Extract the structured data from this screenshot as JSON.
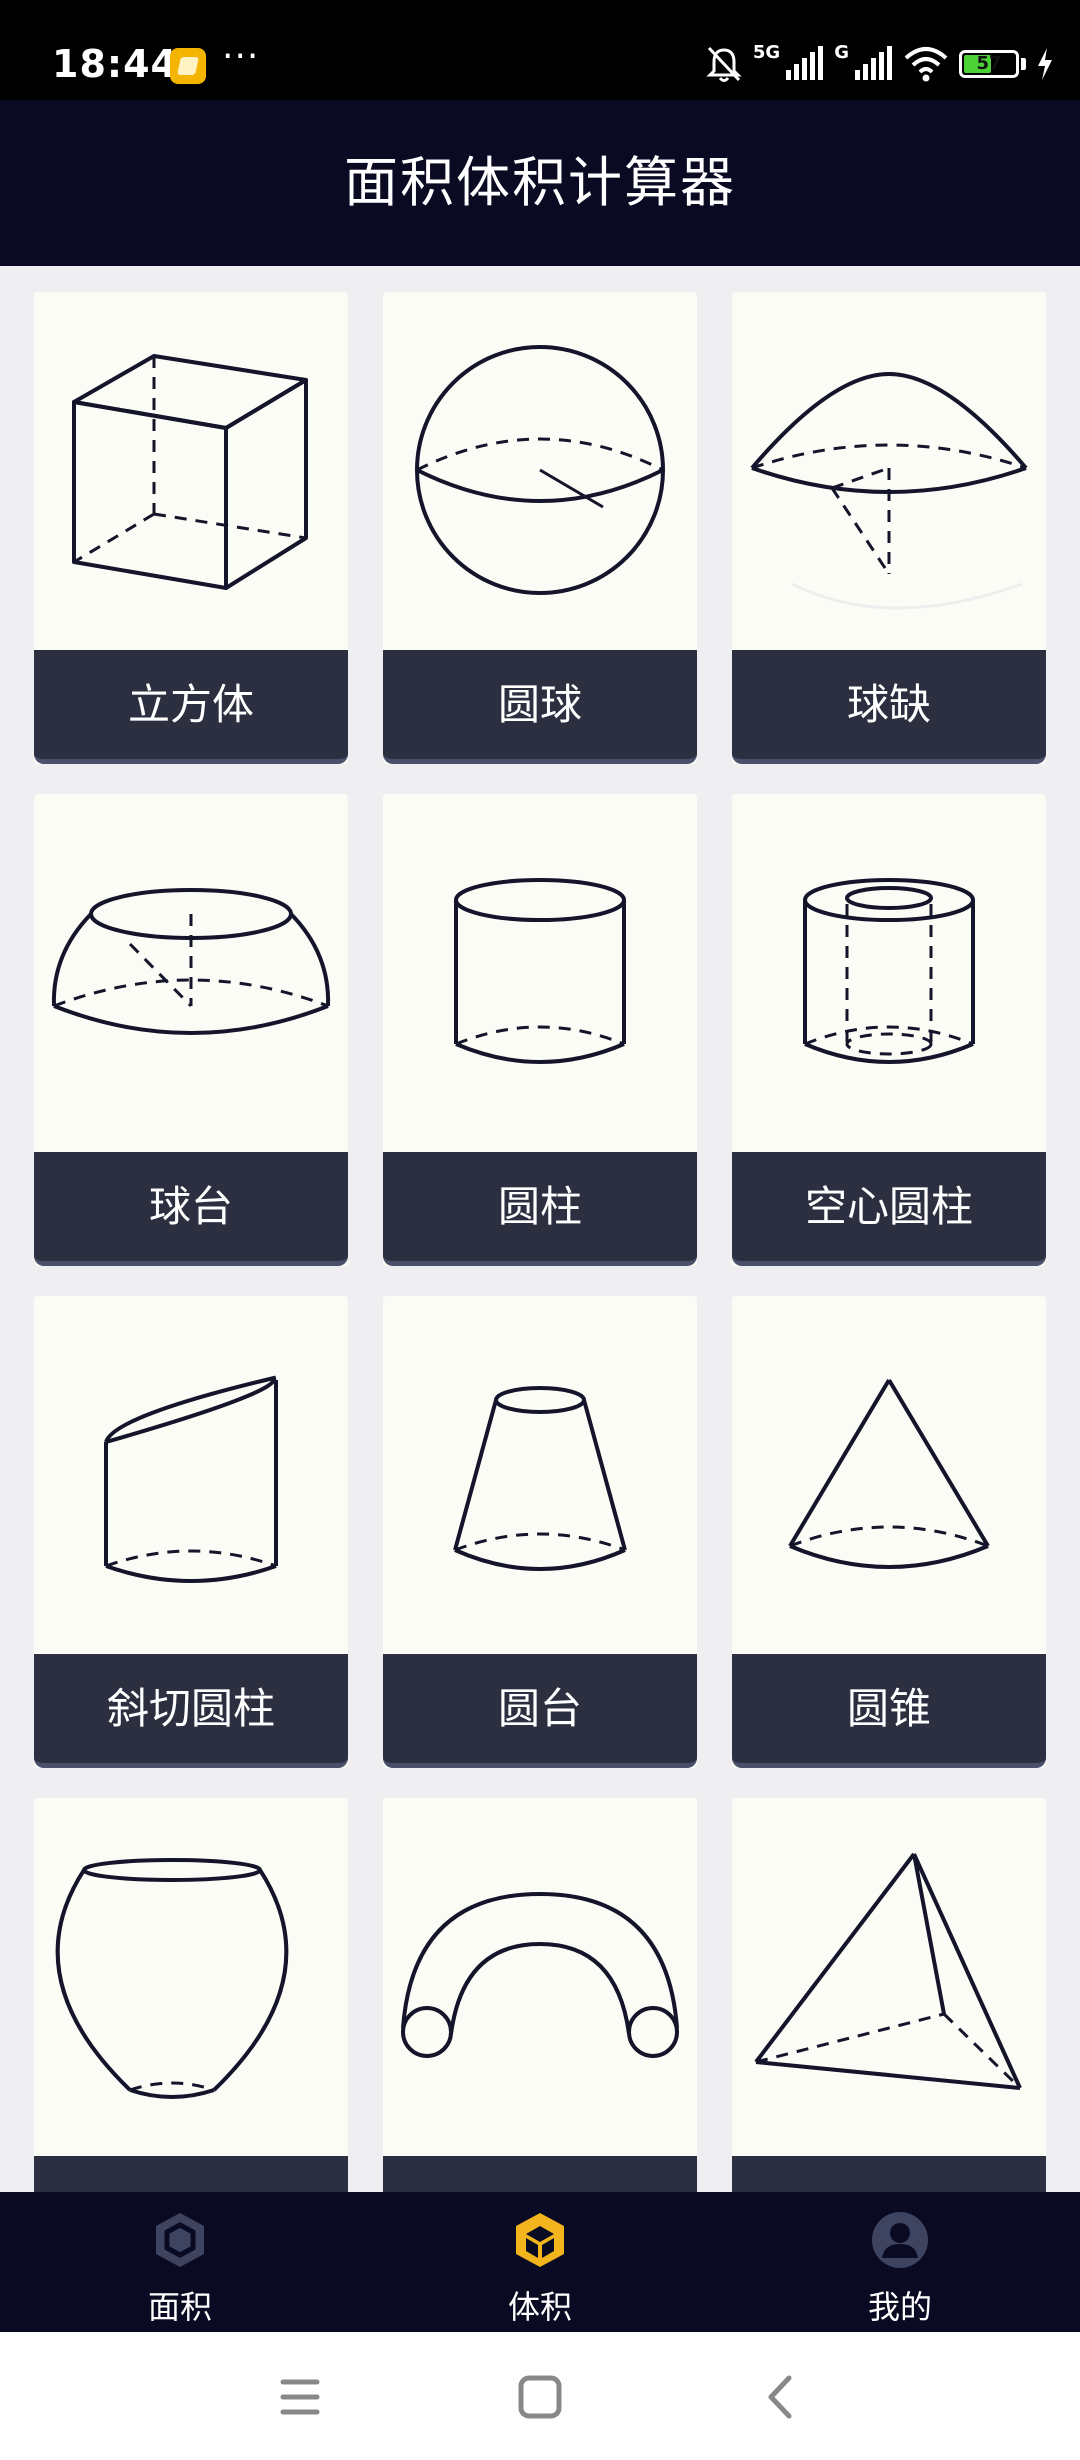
{
  "status_bar": {
    "time": "18:44",
    "more": "···",
    "network_1": "5G",
    "network_2": "G",
    "battery": "57",
    "battery_level": 0.57
  },
  "header": {
    "title": "面积体积计算器"
  },
  "shapes": [
    {
      "label": "立方体",
      "icon": "cube-icon"
    },
    {
      "label": "圆球",
      "icon": "sphere-icon"
    },
    {
      "label": "球缺",
      "icon": "spherical-cap-icon"
    },
    {
      "label": "球台",
      "icon": "spherical-segment-icon"
    },
    {
      "label": "圆柱",
      "icon": "cylinder-icon"
    },
    {
      "label": "空心圆柱",
      "icon": "hollow-cylinder-icon"
    },
    {
      "label": "斜切圆柱",
      "icon": "oblique-cylinder-icon"
    },
    {
      "label": "圆台",
      "icon": "frustum-icon"
    },
    {
      "label": "圆锥",
      "icon": "cone-icon"
    },
    {
      "label": "",
      "icon": "barrel-icon"
    },
    {
      "label": "",
      "icon": "torus-icon"
    },
    {
      "label": "",
      "icon": "tetrahedron-icon"
    }
  ],
  "bottom_nav": {
    "items": [
      {
        "label": "面积",
        "icon": "hexagon-icon",
        "active": false
      },
      {
        "label": "体积",
        "icon": "cube-gold-icon",
        "active": true
      },
      {
        "label": "我的",
        "icon": "user-icon",
        "active": false
      }
    ],
    "active_color": "#f2b51d",
    "inactive_color": "#3e4460"
  },
  "system_nav": {
    "items": [
      "menu-icon",
      "home-icon",
      "back-icon"
    ]
  }
}
